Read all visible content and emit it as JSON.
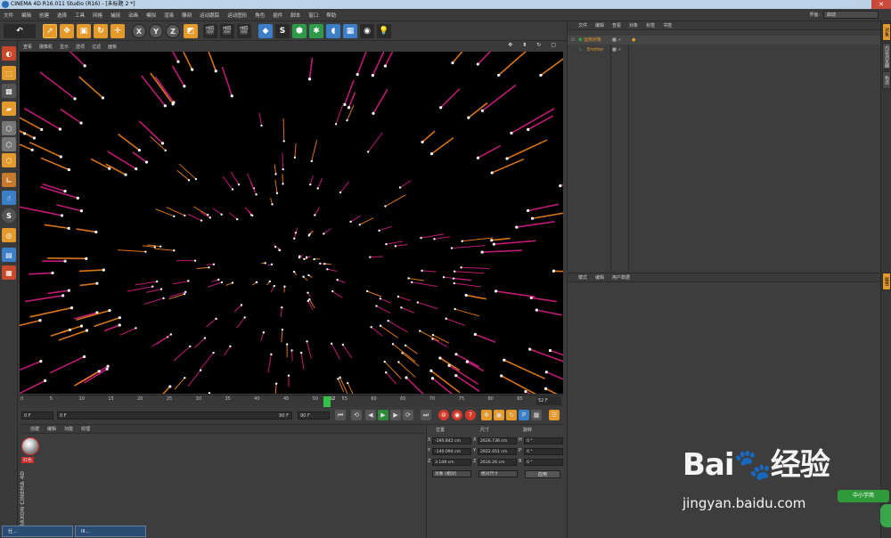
{
  "window": {
    "title": "CINEMA 4D R16.011 Studio (R16) - [未标题 2 *]",
    "controls": [
      "–",
      "□",
      "✕"
    ]
  },
  "menubar": [
    "文件",
    "编辑",
    "创建",
    "选择",
    "工具",
    "网格",
    "捕捉",
    "动画",
    "模拟",
    "渲染",
    "雕刻",
    "运动跟踪",
    "运动图形",
    "角色",
    "插件",
    "脚本",
    "窗口",
    "帮助"
  ],
  "layout": {
    "label": "界面:",
    "value": "启动"
  },
  "toolbar": {
    "axis_x": "X",
    "axis_y": "Y",
    "axis_z": "Z"
  },
  "viewport": {
    "menu": [
      "查看",
      "摄像机",
      "显示",
      "选项",
      "过滤",
      "面板"
    ],
    "nav_icons": [
      "move-view-icon",
      "zoom-view-icon",
      "rotate-view-icon",
      "maximize-view-icon"
    ]
  },
  "timeline": {
    "ticks": [
      "0",
      "5",
      "10",
      "15",
      "20",
      "25",
      "30",
      "35",
      "40",
      "45",
      "50",
      "52",
      "55",
      "60",
      "65",
      "70",
      "75",
      "80",
      "85",
      "90"
    ],
    "current_frame": "52",
    "current_frame_readout": "52 F",
    "total_frames": 90
  },
  "transport": {
    "start_field": "0 F",
    "range_start": "0 F",
    "range_end": "90 F",
    "end_field": "90 F"
  },
  "material_panel": {
    "menu": [
      "创建",
      "编辑",
      "功能",
      "纹理"
    ],
    "material_name": "红色",
    "brand": "MAXON CINEMA 4D"
  },
  "coord_panel": {
    "headers": {
      "position": "位置",
      "size": "尺寸",
      "rotation": "旋转"
    },
    "rows": [
      {
        "axis": "X",
        "pos": "-195.842 cm",
        "size_axis": "X",
        "size": "2626.736 cm",
        "rot_axis": "H",
        "rot": "0 °"
      },
      {
        "axis": "Y",
        "pos": "-140.094 cm",
        "size_axis": "Y",
        "size": "2922.451 cm",
        "rot_axis": "P",
        "rot": "0 °"
      },
      {
        "axis": "Z",
        "pos": "3.149 cm",
        "size_axis": "Z",
        "size": "2616.26 cm",
        "rot_axis": "B",
        "rot": "0 °"
      }
    ],
    "mode_dropdown": "对象 (相对)",
    "size_dropdown": "绝对尺寸",
    "apply": "应用"
  },
  "object_panel": {
    "menu": [
      "文件",
      "编辑",
      "查看",
      "对象",
      "标签",
      "书签"
    ],
    "objects": [
      {
        "name": "运用对象",
        "color": "#e49a2a"
      },
      {
        "name": "Emitter",
        "color": "#e49a2a"
      }
    ]
  },
  "attr_panel": {
    "menu": [
      "模式",
      "编辑",
      "用户数据"
    ]
  },
  "right_tabs": [
    "对象",
    "内容浏览器",
    "构造"
  ],
  "right_tabs_lower": [
    "属性"
  ],
  "taskbar": [
    "仕...",
    "III..."
  ],
  "watermark": {
    "logo": "Bai🐾经验",
    "url": "jingyan.baidu.com",
    "badge": "中小学简"
  },
  "colors": {
    "particle_hot": "#ff8a1a",
    "particle_pink": "#e0208a",
    "particle_head": "#ffffff",
    "accent_orange": "#e49a2a",
    "playhead": "#36c14a"
  }
}
